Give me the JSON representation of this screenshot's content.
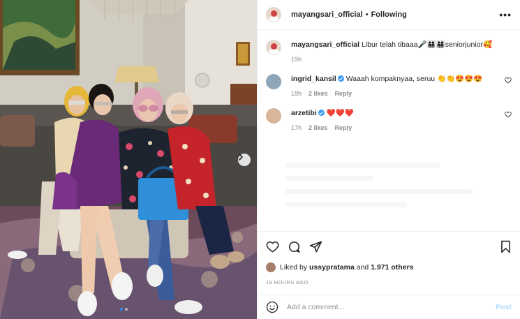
{
  "post": {
    "username": "mayangsari_official",
    "follow_status": "Following",
    "more_icon": "more-horizontal-icon"
  },
  "caption": {
    "username": "mayangsari_official",
    "text": "Libur telah tibaaa🎤👨‍👩‍👧‍👦👨‍👩‍👧‍👦seniorjunior🥰",
    "time": "19h"
  },
  "comments": [
    {
      "username": "ingrid_kansil",
      "verified": true,
      "text": "Waaah kompaknyaa, seruu 👏👏😍😍😍",
      "time": "18h",
      "likes": "2 likes",
      "reply": "Reply",
      "avatar_color": "#8fa6b8"
    },
    {
      "username": "arzetibi",
      "verified": true,
      "text": "❤️❤️❤️",
      "time": "17h",
      "likes": "2 likes",
      "reply": "Reply",
      "avatar_color": "#d9b59a"
    }
  ],
  "actions": {
    "like_icon": "heart-icon",
    "comment_icon": "comment-icon",
    "share_icon": "share-icon",
    "save_icon": "bookmark-icon"
  },
  "likes": {
    "prefix": "Liked by",
    "user": "ussypratama",
    "middle": "and",
    "count": "1.971 others"
  },
  "timestamp": "19 HOURS AGO",
  "add_comment": {
    "placeholder": "Add a comment...",
    "post_label": "Post",
    "emoji_icon": "emoji-icon"
  },
  "colors": {
    "accent": "#3897f0",
    "post_disabled": "#b3dbff",
    "heart_red": "#ed4956"
  }
}
